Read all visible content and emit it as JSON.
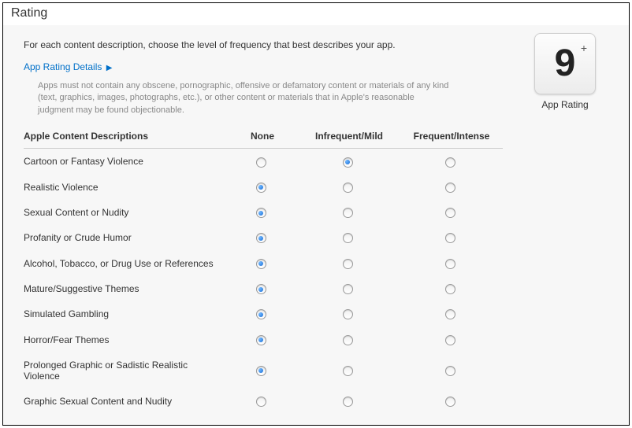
{
  "panel_title": "Rating",
  "intro": "For each content description, choose the level of frequency that best describes your app.",
  "link_label": "App Rating Details",
  "disclaimer": "Apps must not contain any obscene, pornographic, offensive or defamatory content or materials of any kind (text, graphics, images, photographs, etc.), or other content or materials that in Apple's reasonable judgment may be found objectionable.",
  "columns": {
    "desc": "Apple Content Descriptions",
    "none": "None",
    "mild": "Infrequent/Mild",
    "intense": "Frequent/Intense"
  },
  "rows": [
    {
      "label": "Cartoon or Fantasy Violence",
      "selected": "mild"
    },
    {
      "label": "Realistic Violence",
      "selected": "none"
    },
    {
      "label": "Sexual Content or Nudity",
      "selected": "none"
    },
    {
      "label": "Profanity or Crude Humor",
      "selected": "none"
    },
    {
      "label": "Alcohol, Tobacco, or Drug Use or References",
      "selected": "none"
    },
    {
      "label": "Mature/Suggestive Themes",
      "selected": "none"
    },
    {
      "label": "Simulated Gambling",
      "selected": "none"
    },
    {
      "label": "Horror/Fear Themes",
      "selected": "none"
    },
    {
      "label": "Prolonged Graphic or Sadistic Realistic Violence",
      "selected": "none"
    },
    {
      "label": "Graphic Sexual Content and Nudity",
      "selected": ""
    }
  ],
  "app_rating": {
    "value": "9",
    "plus": "+",
    "label": "App Rating"
  }
}
